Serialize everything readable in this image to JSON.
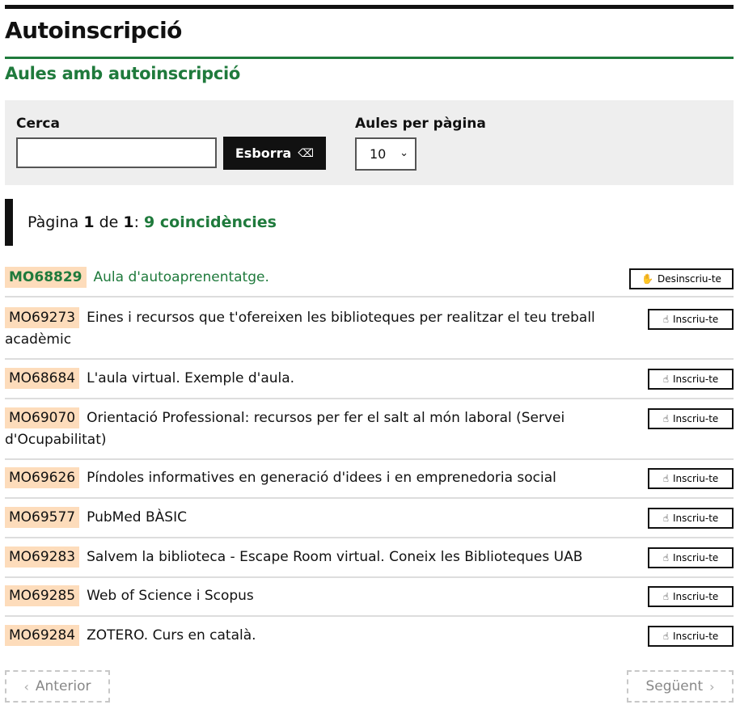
{
  "header": {
    "title": "Autoinscripció"
  },
  "section": {
    "title": "Aules amb autoinscripció"
  },
  "filters": {
    "search_label": "Cerca",
    "search_value": "",
    "search_placeholder": "",
    "clear_label": "Esborra",
    "per_page_label": "Aules per pàgina",
    "per_page_value": "10"
  },
  "results": {
    "prefix": "Pàgina",
    "page": "1",
    "of": "de",
    "total_pages": "1",
    "colon": ":",
    "matches": "9 coincidències"
  },
  "courses": [
    {
      "code": "MO68829",
      "title": "Aula d'autoaprenentatge.",
      "action": "Desinscriu-te",
      "action_icon": "hand-wave-icon",
      "enrolled": true
    },
    {
      "code": "MO69273",
      "title": "Eines i recursos que t'ofereixen les biblioteques per realitzar el teu treball acadèmic",
      "action": "Inscriu-te",
      "action_icon": "hand-pointer-icon",
      "enrolled": false
    },
    {
      "code": "MO68684",
      "title": "L'aula virtual. Exemple d'aula.",
      "action": "Inscriu-te",
      "action_icon": "hand-pointer-icon",
      "enrolled": false
    },
    {
      "code": "MO69070",
      "title": "Orientació Professional: recursos per fer el salt al món laboral (Servei d'Ocupabilitat)",
      "action": "Inscriu-te",
      "action_icon": "hand-pointer-icon",
      "enrolled": false
    },
    {
      "code": "MO69626",
      "title": "Píndoles informatives en generació d'idees i en emprenedoria social",
      "action": "Inscriu-te",
      "action_icon": "hand-pointer-icon",
      "enrolled": false
    },
    {
      "code": "MO69577",
      "title": "PubMed BÀSIC",
      "action": "Inscriu-te",
      "action_icon": "hand-pointer-icon",
      "enrolled": false
    },
    {
      "code": "MO69283",
      "title": "Salvem la biblioteca - Escape Room virtual. Coneix les Biblioteques UAB",
      "action": "Inscriu-te",
      "action_icon": "hand-pointer-icon",
      "enrolled": false
    },
    {
      "code": "MO69285",
      "title": "Web of Science i Scopus",
      "action": "Inscriu-te",
      "action_icon": "hand-pointer-icon",
      "enrolled": false
    },
    {
      "code": "MO69284",
      "title": "ZOTERO. Curs en català.",
      "action": "Inscriu-te",
      "action_icon": "hand-pointer-icon",
      "enrolled": false
    }
  ],
  "pagination": {
    "prev_label": "Anterior",
    "next_label": "Següent"
  },
  "colors": {
    "accent": "#1f7a3c",
    "code_bg": "#fddcbb",
    "dark": "#111111"
  }
}
